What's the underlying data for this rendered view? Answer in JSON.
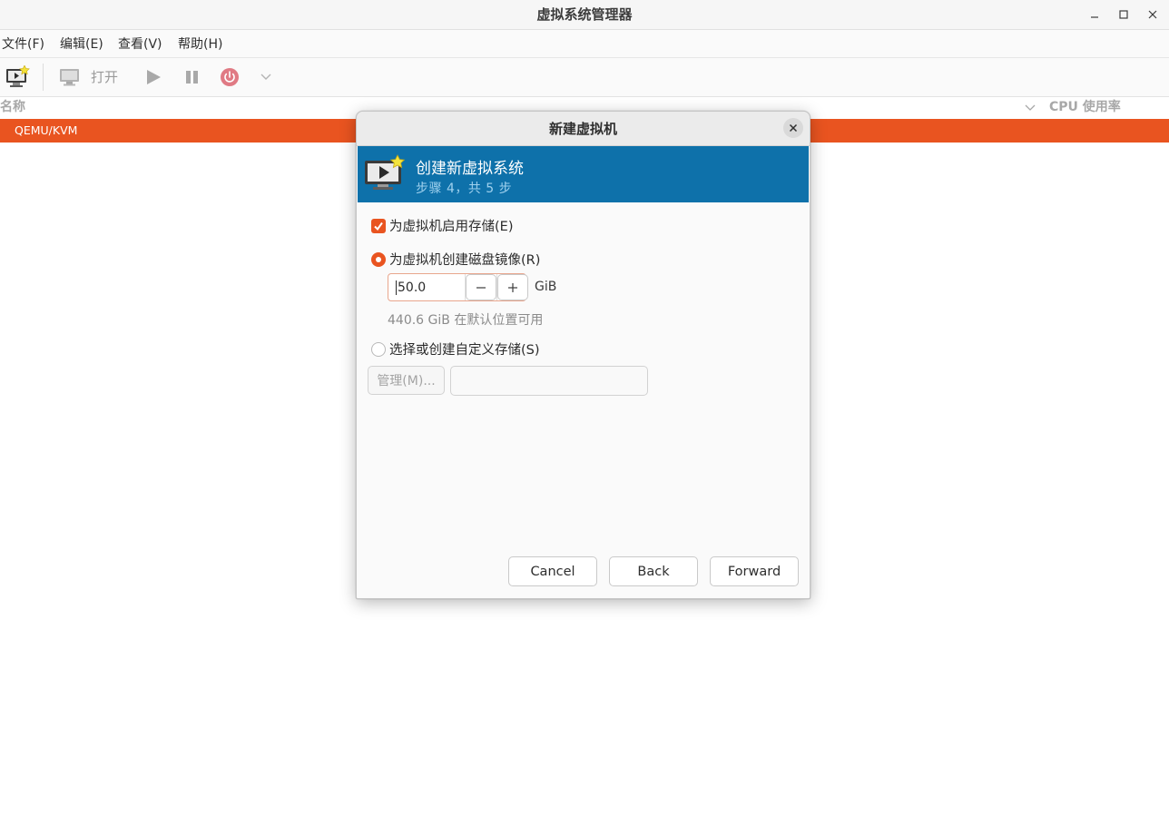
{
  "window": {
    "title": "虚拟系统管理器"
  },
  "menubar": {
    "items": [
      "文件(F)",
      "编辑(E)",
      "查看(V)",
      "帮助(H)"
    ]
  },
  "toolbar": {
    "open_label": "打开"
  },
  "list": {
    "col_name": "名称",
    "col_cpu": "CPU 使用率",
    "rows": [
      {
        "label": "QEMU/KVM"
      }
    ]
  },
  "dialog": {
    "title": "新建虚拟机",
    "banner_title": "创建新虚拟系统",
    "banner_step": "步骤 4，共 5 步",
    "enable_storage_label": "为虚拟机启用存储(E)",
    "enable_storage_checked": true,
    "create_disk_label": "为虚拟机创建磁盘镜像(R)",
    "create_disk_selected": true,
    "disk_size": "50.0",
    "disk_unit": "GiB",
    "available_text": "440.6 GiB 在默认位置可用",
    "custom_storage_label": "选择或创建自定义存储(S)",
    "custom_storage_selected": false,
    "manage_button": "管理(M)...",
    "custom_path_value": "",
    "cancel_button": "Cancel",
    "back_button": "Back",
    "forward_button": "Forward"
  },
  "colors": {
    "accent": "#e95420",
    "banner": "#0e71aa"
  },
  "icons": {
    "window": [
      "minimize-icon",
      "maximize-icon",
      "close-icon"
    ],
    "toolbar": [
      "new-vm-icon",
      "monitor-icon",
      "play-icon",
      "pause-icon",
      "power-icon",
      "chevron-down-icon"
    ]
  }
}
